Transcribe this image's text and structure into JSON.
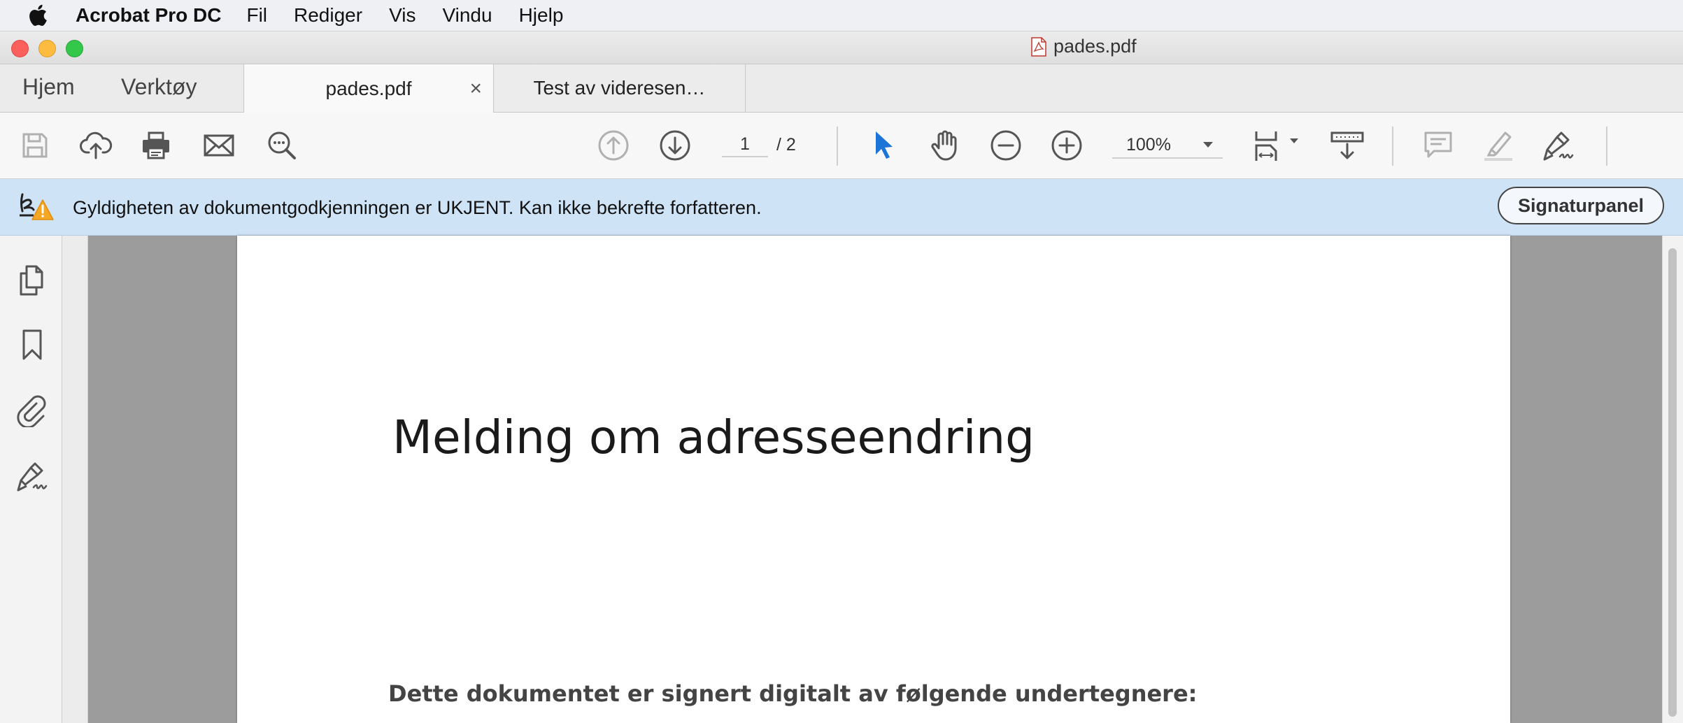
{
  "menubar": {
    "app_name": "Acrobat Pro DC",
    "items": [
      "Fil",
      "Rediger",
      "Vis",
      "Vindu",
      "Hjelp"
    ]
  },
  "window": {
    "title": "pades.pdf"
  },
  "tabs": {
    "home": "Hjem",
    "tools": "Verktøy",
    "documents": [
      {
        "label": "pades.pdf",
        "active": true,
        "close": "×"
      },
      {
        "label": "Test av videresen…",
        "active": false
      }
    ]
  },
  "toolbar": {
    "page_current": "1",
    "page_total": "/ 2",
    "zoom": "100%",
    "icons": [
      "save-icon",
      "upload-icon",
      "print-icon",
      "email-icon",
      "search-icon",
      "page-up-icon",
      "page-down-icon",
      "select-cursor-icon",
      "hand-icon",
      "zoom-out-icon",
      "zoom-in-icon",
      "fit-page-icon",
      "read-mode-icon",
      "comment-icon",
      "highlight-icon",
      "sign-icon"
    ],
    "accent_color": "#1b74d6"
  },
  "signature_bar": {
    "message": "Gyldigheten av dokumentgodkjenningen er UKJENT. Kan ikke bekrefte forfatteren.",
    "button": "Signaturpanel",
    "background": "#cfe3f6",
    "warning_color": "#f5a623"
  },
  "left_pane": {
    "icons": [
      "pages-icon",
      "bookmark-icon",
      "attachment-icon",
      "signature-icon"
    ]
  },
  "document": {
    "heading": "Melding om adresseendring",
    "subheading": "Dette dokumentet er signert digitalt av følgende undertegnere:"
  }
}
